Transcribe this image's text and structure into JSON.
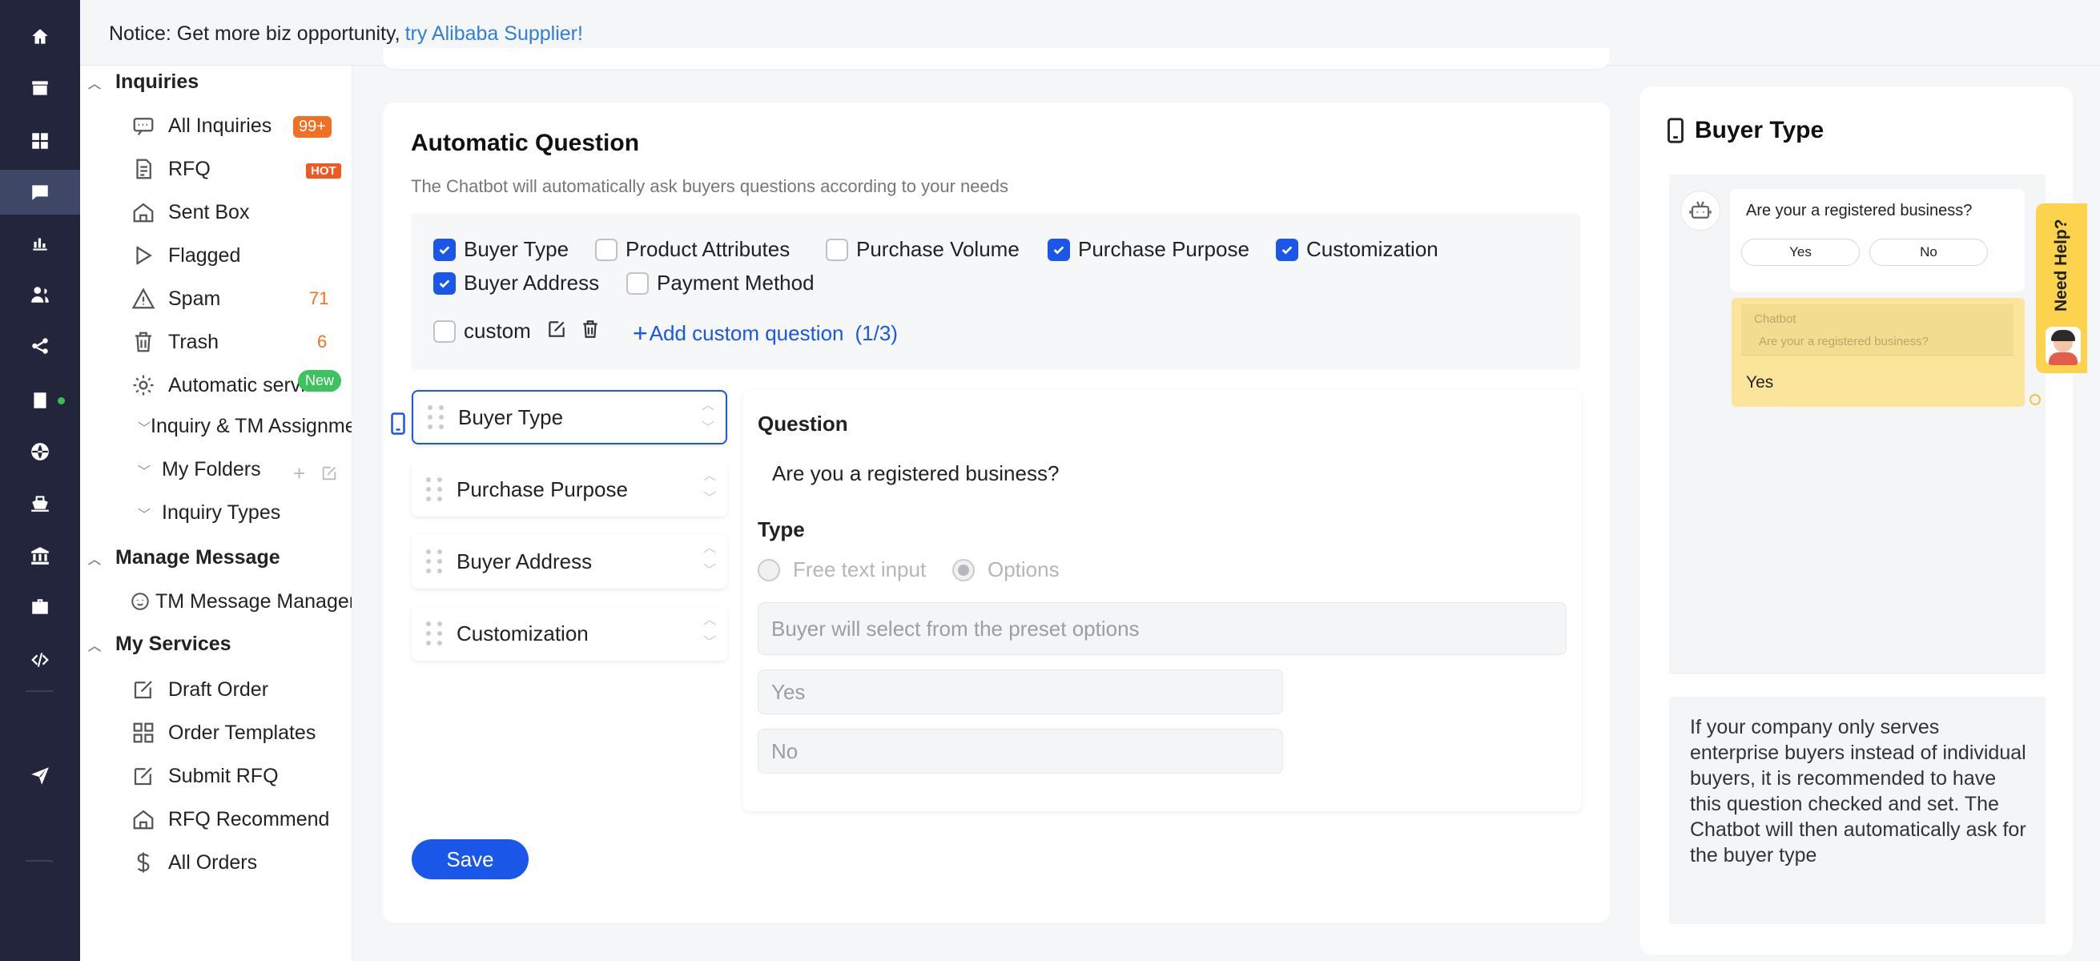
{
  "notice": {
    "prefix": "Notice: Get more biz opportunity,",
    "link": "try Alibaba Supplier!"
  },
  "rail_icons": [
    "home-icon",
    "store-icon",
    "apps-icon",
    "message-icon",
    "chart-icon",
    "users-icon",
    "share-icon",
    "orders-icon",
    "globe-icon",
    "ship-icon",
    "bank-icon",
    "briefcase-icon",
    "code-icon",
    "send-icon"
  ],
  "menu": {
    "inquiries": "Inquiries",
    "all_inquiries": "All Inquiries",
    "all_inquiries_badge": "99+",
    "rfq": "RFQ",
    "rfq_hot": "HOT",
    "sent_box": "Sent Box",
    "flagged": "Flagged",
    "spam": "Spam",
    "spam_count": "71",
    "trash": "Trash",
    "trash_count": "6",
    "automatic": "Automatic services",
    "automatic_badge": "New",
    "inquiry_tm": "Inquiry & TM Assignment",
    "my_folders": "My Folders",
    "inquiry_types": "Inquiry Types",
    "manage_message": "Manage Message",
    "tm_message": "TM Message Management",
    "my_services": "My Services",
    "draft_order": "Draft Order",
    "order_templates": "Order Templates",
    "submit_rfq": "Submit RFQ",
    "rfq_recommend": "RFQ Recommend",
    "all_orders": "All Orders"
  },
  "main": {
    "title": "Automatic Question",
    "subtitle": "The Chatbot will automatically ask buyers questions according to your needs",
    "options": [
      {
        "label": "Buyer Type",
        "checked": true
      },
      {
        "label": "Product Attributes",
        "checked": false
      },
      {
        "label": "Purchase Volume",
        "checked": false
      },
      {
        "label": "Purchase Purpose",
        "checked": true
      },
      {
        "label": "Customization",
        "checked": true
      },
      {
        "label": "Buyer Address",
        "checked": true
      },
      {
        "label": "Payment Method",
        "checked": false
      }
    ],
    "custom_label": "custom",
    "add_custom": "Add custom question",
    "add_custom_count": "(1/3)",
    "questions": [
      "Buyer Type",
      "Purchase Purpose",
      "Buyer Address",
      "Customization"
    ],
    "detail": {
      "question_heading": "Question",
      "question_text": "Are you a registered business?",
      "type_heading": "Type",
      "type_free": "Free text input",
      "type_options": "Options",
      "options_hint": "Buyer will select from the preset options",
      "option_yes": "Yes",
      "option_no": "No"
    },
    "save": "Save"
  },
  "preview": {
    "title": "Buyer Type",
    "bubble_question": "Are your a registered business?",
    "btn_yes": "Yes",
    "btn_no": "No",
    "quote_sender": "Chatbot",
    "quote_text": "Are your a registered business?",
    "reply": "Yes",
    "need_help": "Need Help?",
    "description": "If your company only serves enterprise buyers instead of individual buyers, it is recommended to have this question checked and set. The Chatbot will then automatically ask for the buyer type"
  }
}
